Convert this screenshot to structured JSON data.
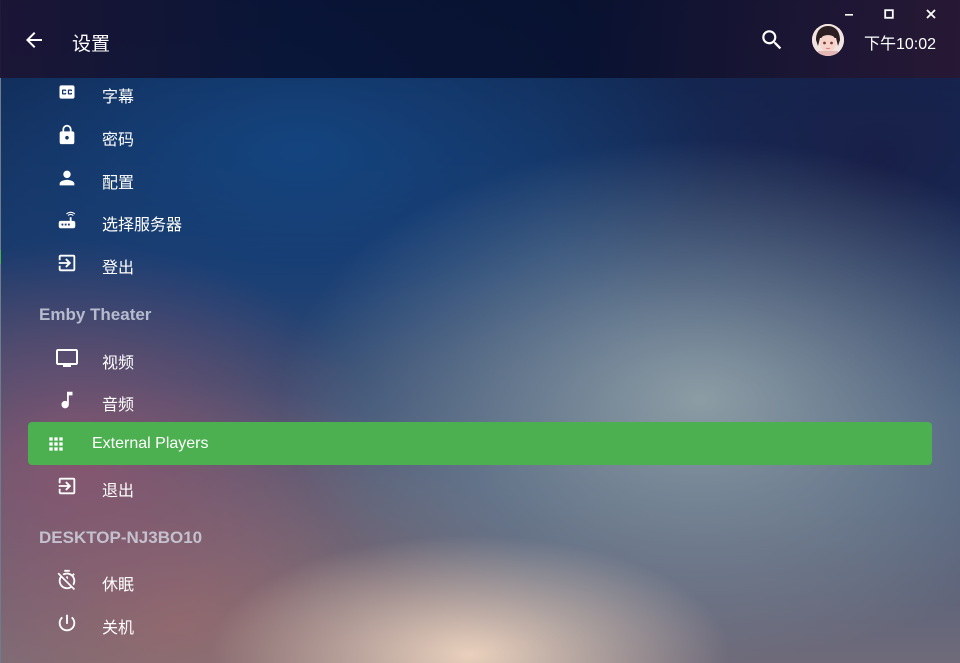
{
  "header": {
    "title": "设置",
    "clock": "下午10:02"
  },
  "menu": {
    "items_top": [
      {
        "label": "字幕",
        "icon": "closed-caption-icon"
      },
      {
        "label": "密码",
        "icon": "lock-icon"
      },
      {
        "label": "配置",
        "icon": "person-icon"
      },
      {
        "label": "选择服务器",
        "icon": "router-icon"
      },
      {
        "label": "登出",
        "icon": "exit-icon"
      }
    ],
    "section_app": "Emby Theater",
    "items_app": [
      {
        "label": "视频",
        "icon": "monitor-icon"
      },
      {
        "label": "音频",
        "icon": "music-note-icon"
      },
      {
        "label": "External Players",
        "icon": "grid-icon",
        "selected": true
      },
      {
        "label": "退出",
        "icon": "exit-icon"
      }
    ],
    "section_device": "DESKTOP-NJ3BO10",
    "items_device": [
      {
        "label": "休眠",
        "icon": "timer-off-icon"
      },
      {
        "label": "关机",
        "icon": "power-icon"
      }
    ]
  },
  "colors": {
    "accent": "#4caf50"
  }
}
